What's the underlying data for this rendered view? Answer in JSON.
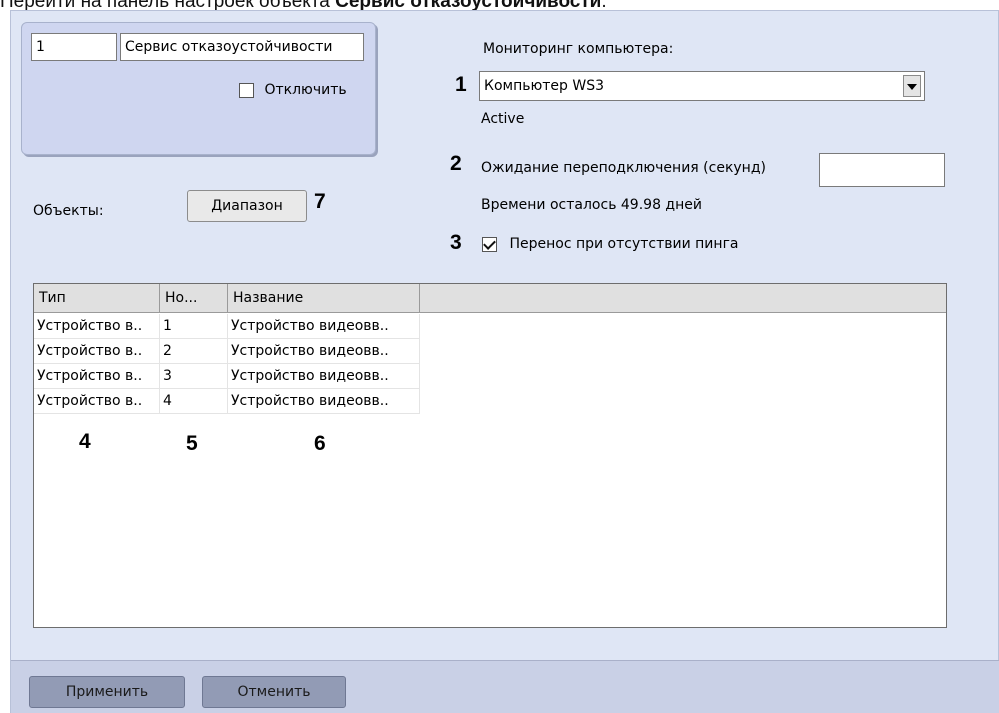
{
  "caption": {
    "prefix": "Перейти на панель настроек объекта ",
    "object_name": "Сервис отказоустойчивости",
    "suffix": "."
  },
  "object": {
    "id": "1",
    "name": "Сервис отказоустойчивости",
    "disable_label": "Отключить",
    "disable_checked": false
  },
  "monitoring": {
    "label": "Мониторинг компьютера:",
    "marker": "1",
    "selected": "Компьютер WS3",
    "status": "Active"
  },
  "reconnect": {
    "marker": "2",
    "label": "Ожидание переподключения (секунд)",
    "value": ""
  },
  "time_left": "Времени осталось 49.98 дней",
  "ping": {
    "marker": "3",
    "label": "Перенос при отсутствии пинга",
    "checked": true
  },
  "objects": {
    "label": "Объекты:",
    "range_button": "Диапазон",
    "range_marker": "7"
  },
  "table": {
    "columns": [
      "Тип",
      "Но...",
      "Название"
    ],
    "rows": [
      [
        "Устройство в..",
        "1",
        "Устройство видеовв.."
      ],
      [
        "Устройство в..",
        "2",
        "Устройство видеовв.."
      ],
      [
        "Устройство в..",
        "3",
        "Устройство видеовв.."
      ],
      [
        "Устройство в..",
        "4",
        "Устройство видеовв.."
      ]
    ],
    "column_markers": [
      "4",
      "5",
      "6"
    ]
  },
  "footer": {
    "apply": "Применить",
    "cancel": "Отменить"
  },
  "colors": {
    "panel_bg": "#dfe6f5",
    "group_bg": "#cfd6f0",
    "footer_bg": "#c9d0e6",
    "footer_button": "#929bb5"
  }
}
